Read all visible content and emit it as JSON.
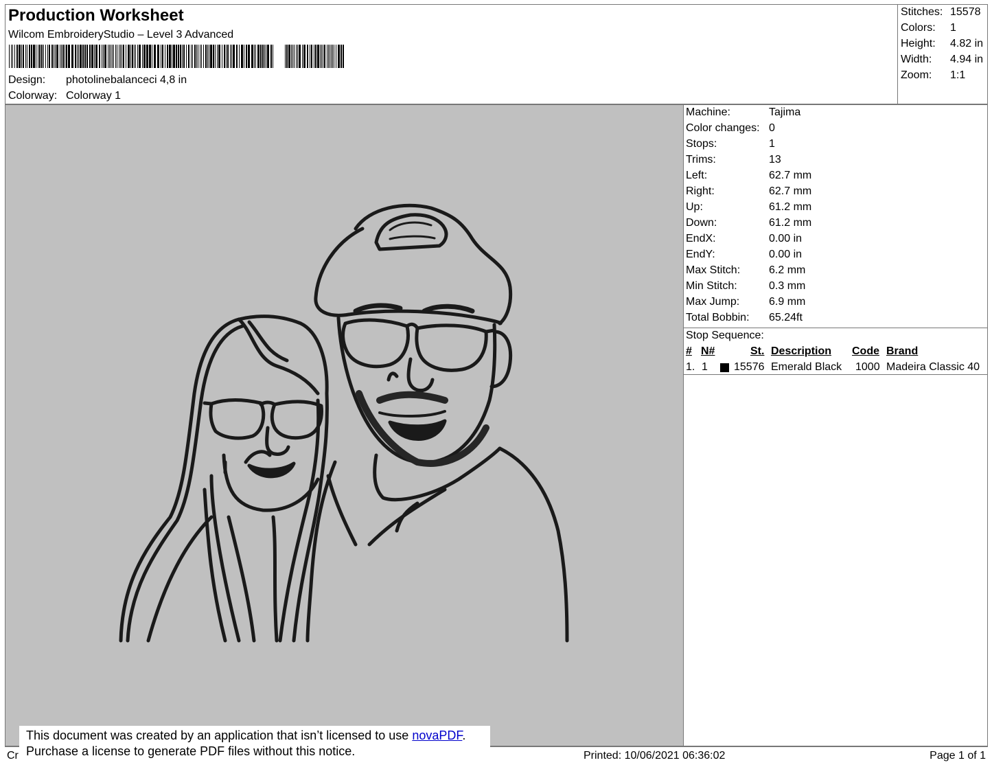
{
  "header": {
    "title": "Production Worksheet",
    "software": "Wilcom EmbroideryStudio – Level 3 Advanced",
    "design_label": "Design:",
    "design_value": "photolinebalanceci 4,8 in",
    "colorway_label": "Colorway:",
    "colorway_value": "Colorway 1"
  },
  "stats": [
    {
      "label": "Stitches:",
      "value": "15578"
    },
    {
      "label": "Colors:",
      "value": "1"
    },
    {
      "label": "Height:",
      "value": "4.82 in"
    },
    {
      "label": "Width:",
      "value": "4.94 in"
    },
    {
      "label": "Zoom:",
      "value": "1:1"
    }
  ],
  "machine_info": [
    {
      "label": "Machine:",
      "value": "Tajima"
    },
    {
      "label": "Color changes:",
      "value": "0"
    },
    {
      "label": "Stops:",
      "value": "1"
    },
    {
      "label": "Trims:",
      "value": "13"
    },
    {
      "label": "Left:",
      "value": "62.7 mm"
    },
    {
      "label": "Right:",
      "value": "62.7 mm"
    },
    {
      "label": "Up:",
      "value": "61.2 mm"
    },
    {
      "label": "Down:",
      "value": "61.2 mm"
    },
    {
      "label": "EndX:",
      "value": "0.00 in"
    },
    {
      "label": "EndY:",
      "value": "0.00 in"
    },
    {
      "label": "Max Stitch:",
      "value": "6.2 mm"
    },
    {
      "label": "Min Stitch:",
      "value": "0.3 mm"
    },
    {
      "label": "Max Jump:",
      "value": "6.9 mm"
    },
    {
      "label": "Total Bobbin:",
      "value": "65.24ft"
    }
  ],
  "stop_sequence": {
    "label": "Stop Sequence:",
    "headers": {
      "num": "#",
      "n": "N#",
      "st": "St.",
      "description": "Description",
      "code": "Code",
      "brand": "Brand"
    },
    "rows": [
      {
        "num": "1.",
        "n": "1",
        "swatch_color": "#000000",
        "st": "15576",
        "description": "Emerald Black",
        "code": "1000",
        "brand": "Madeira Classic 40"
      }
    ]
  },
  "footer": {
    "created_fragment": "Cr",
    "printed": "Printed: 10/06/2021 06:36:02",
    "page": "Page 1 of 1"
  },
  "notice": {
    "line1_prefix": "This document was created by an application that isn’t licensed to use ",
    "link_text": "novaPDF",
    "line1_suffix": ".",
    "line2": "Purchase a license to generate PDF files without this notice."
  },
  "colors": {
    "preview_background": "#c0c0c0",
    "thread": "#1a1a1a",
    "link": "#0000cc"
  }
}
